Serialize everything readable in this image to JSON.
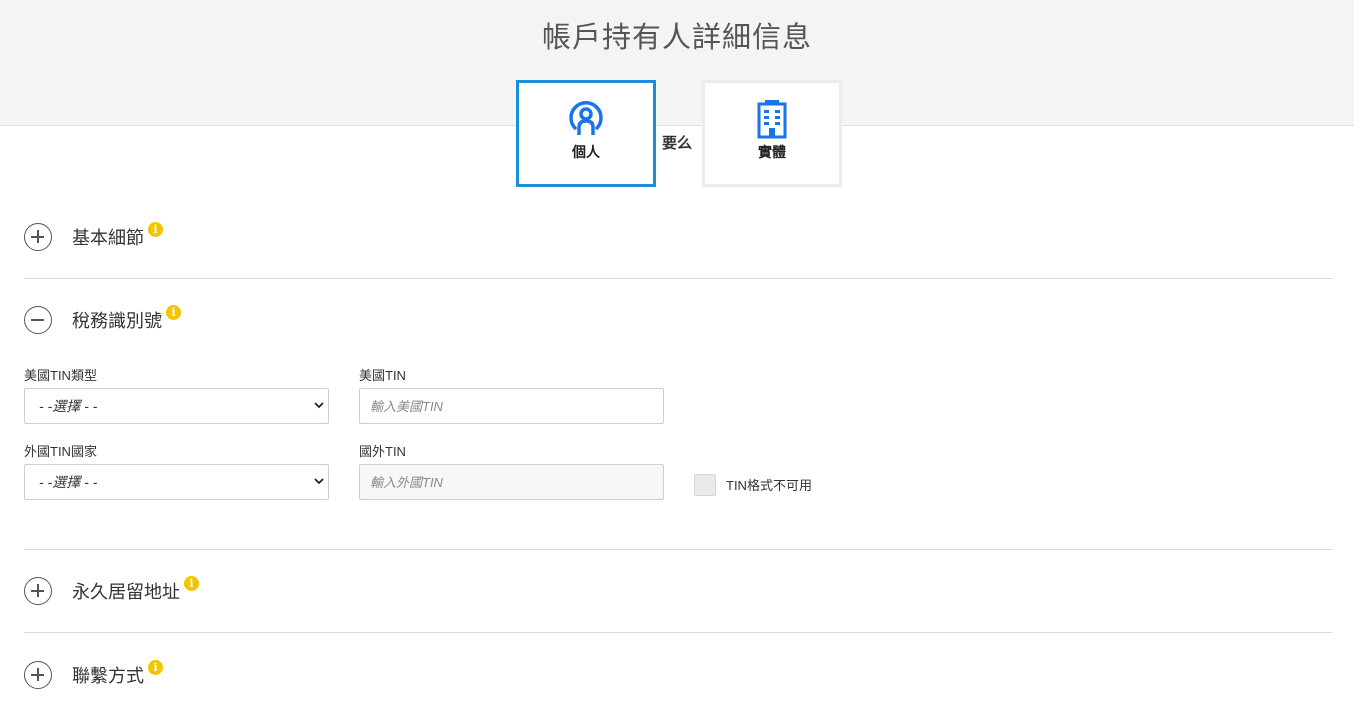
{
  "page": {
    "title": "帳戶持有人詳細信息"
  },
  "account_type": {
    "individual_label": "個人",
    "or_text": "要么",
    "entity_label": "實體",
    "selected": "individual",
    "accent_color": "#1a8fd8"
  },
  "sections": {
    "basic": {
      "title": "基本細節",
      "expanded": false
    },
    "tax": {
      "title": "稅務識別號",
      "expanded": true
    },
    "address": {
      "title": "永久居留地址",
      "expanded": false
    },
    "contact": {
      "title": "聯繫方式",
      "expanded": false
    }
  },
  "tax_form": {
    "us_tin_type": {
      "label": "美國TIN類型",
      "value": "- -選擇 - -"
    },
    "us_tin": {
      "label": "美國TIN",
      "placeholder": "輸入美國TIN"
    },
    "foreign_tin_country": {
      "label": "外國TIN國家",
      "value": "- -選擇 - -"
    },
    "foreign_tin": {
      "label": "國外TIN",
      "placeholder": "輸入外國TIN"
    },
    "tin_unavailable": {
      "label": "TIN格式不可用",
      "checked": false
    }
  },
  "icons": {
    "info": "i",
    "info_color": "#f5c400"
  }
}
